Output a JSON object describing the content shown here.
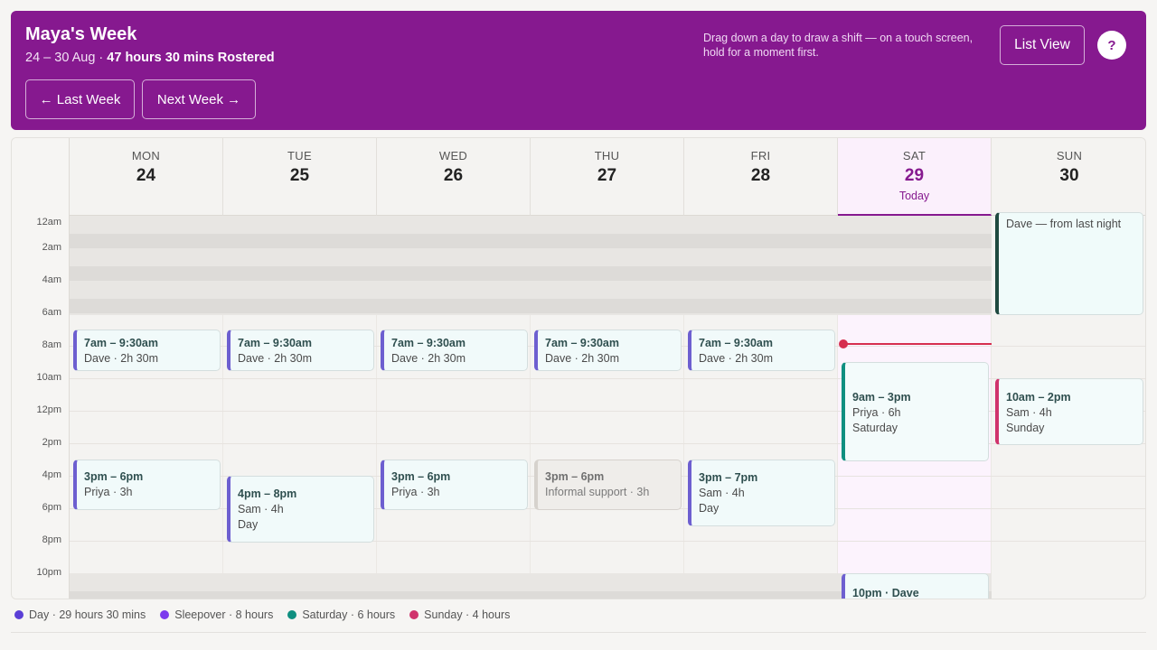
{
  "header": {
    "title": "Maya's Week",
    "date_range": "24 – 30 Aug · ",
    "rostered": "47 hours 30 mins Rostered",
    "last_week": "← Last Week",
    "next_week": "Next Week →",
    "hint": "Drag down a day to draw a shift — on a touch screen, hold for a moment first.",
    "list_view": "List View",
    "help": "?"
  },
  "days": [
    {
      "name": "MON",
      "num": "24"
    },
    {
      "name": "TUE",
      "num": "25"
    },
    {
      "name": "WED",
      "num": "26"
    },
    {
      "name": "THU",
      "num": "27"
    },
    {
      "name": "FRI",
      "num": "28"
    },
    {
      "name": "SAT",
      "num": "29",
      "today": "Today"
    },
    {
      "name": "SUN",
      "num": "30"
    }
  ],
  "time_labels": [
    "12am",
    "2am",
    "4am",
    "6am",
    "8am",
    "10am",
    "12pm",
    "2pm",
    "4pm",
    "6pm",
    "8pm",
    "10pm"
  ],
  "shifts": {
    "mon_am": {
      "time": "7am – 9:30am",
      "detail": "Dave · 2h 30m"
    },
    "tue_am": {
      "time": "7am – 9:30am",
      "detail": "Dave · 2h 30m"
    },
    "wed_am": {
      "time": "7am – 9:30am",
      "detail": "Dave · 2h 30m"
    },
    "thu_am": {
      "time": "7am – 9:30am",
      "detail": "Dave · 2h 30m"
    },
    "fri_am": {
      "time": "7am – 9:30am",
      "detail": "Dave · 2h 30m"
    },
    "mon_pm": {
      "time": "3pm – 6pm",
      "detail": "Priya · 3h"
    },
    "tue_pm": {
      "time": "4pm – 8pm",
      "detail": "Sam · 4h",
      "type": "Day"
    },
    "wed_pm": {
      "time": "3pm – 6pm",
      "detail": "Priya · 3h"
    },
    "thu_pm": {
      "time": "3pm – 6pm",
      "detail": "Informal support · 3h"
    },
    "fri_pm": {
      "time": "3pm – 7pm",
      "detail": "Sam · 4h",
      "type": "Day"
    },
    "sat_day": {
      "time": "9am – 3pm",
      "detail": "Priya · 6h",
      "type": "Saturday"
    },
    "sat_night": {
      "time": "10pm · Dave"
    },
    "sun_sleep": {
      "detail": "Dave — from last night"
    },
    "sun_day": {
      "time": "10am – 2pm",
      "detail": "Sam · 4h",
      "type": "Sunday"
    }
  },
  "legend": [
    {
      "label": "Day · 29 hours 30 mins",
      "color": "#5b3fd6"
    },
    {
      "label": "Sleepover · 8 hours",
      "color": "#7c3aed"
    },
    {
      "label": "Saturday · 6 hours",
      "color": "#0f8f80"
    },
    {
      "label": "Sunday · 4 hours",
      "color": "#d0336c"
    }
  ],
  "colors": {
    "brand": "#86198f",
    "now_line": "#d62f4f"
  }
}
